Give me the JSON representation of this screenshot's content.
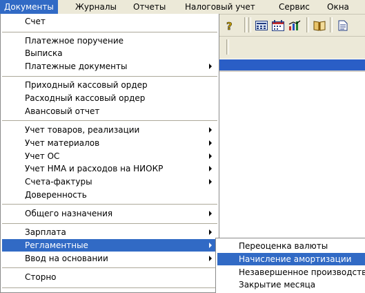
{
  "menubar": {
    "items": [
      "Документы",
      "Журналы",
      "Отчеты",
      "Налоговый учет",
      "Сервис",
      "Окна"
    ]
  },
  "toolbar": {
    "icons": [
      "help-icon",
      "calculator-icon",
      "calendar-icon",
      "chart-icon",
      "book-icon",
      "document-icon"
    ]
  },
  "dropdown": {
    "items": [
      "Счет",
      "Платежное поручение",
      "Выписка",
      "Платежные документы",
      "Приходный кассовый ордер",
      "Расходный кассовый ордер",
      "Авансовый отчет",
      "Учет товаров, реализации",
      "Учет материалов",
      "Учет ОС",
      "Учет НМА и расходов на НИОКР",
      "Счета-фактуры",
      "Доверенность",
      "Общего назначения",
      "Зарплата",
      "Регламентные",
      "Ввод на основании",
      "Сторно"
    ]
  },
  "submenu": {
    "items": [
      "Переоценка валюты",
      "Начисление амортизации",
      "Незавершенное производство",
      "Закрытие месяца"
    ]
  },
  "colors": {
    "menu_highlight": "#316ac5",
    "menubar_bg": "#ece9d8",
    "title_strip": "#2a5ec6"
  }
}
